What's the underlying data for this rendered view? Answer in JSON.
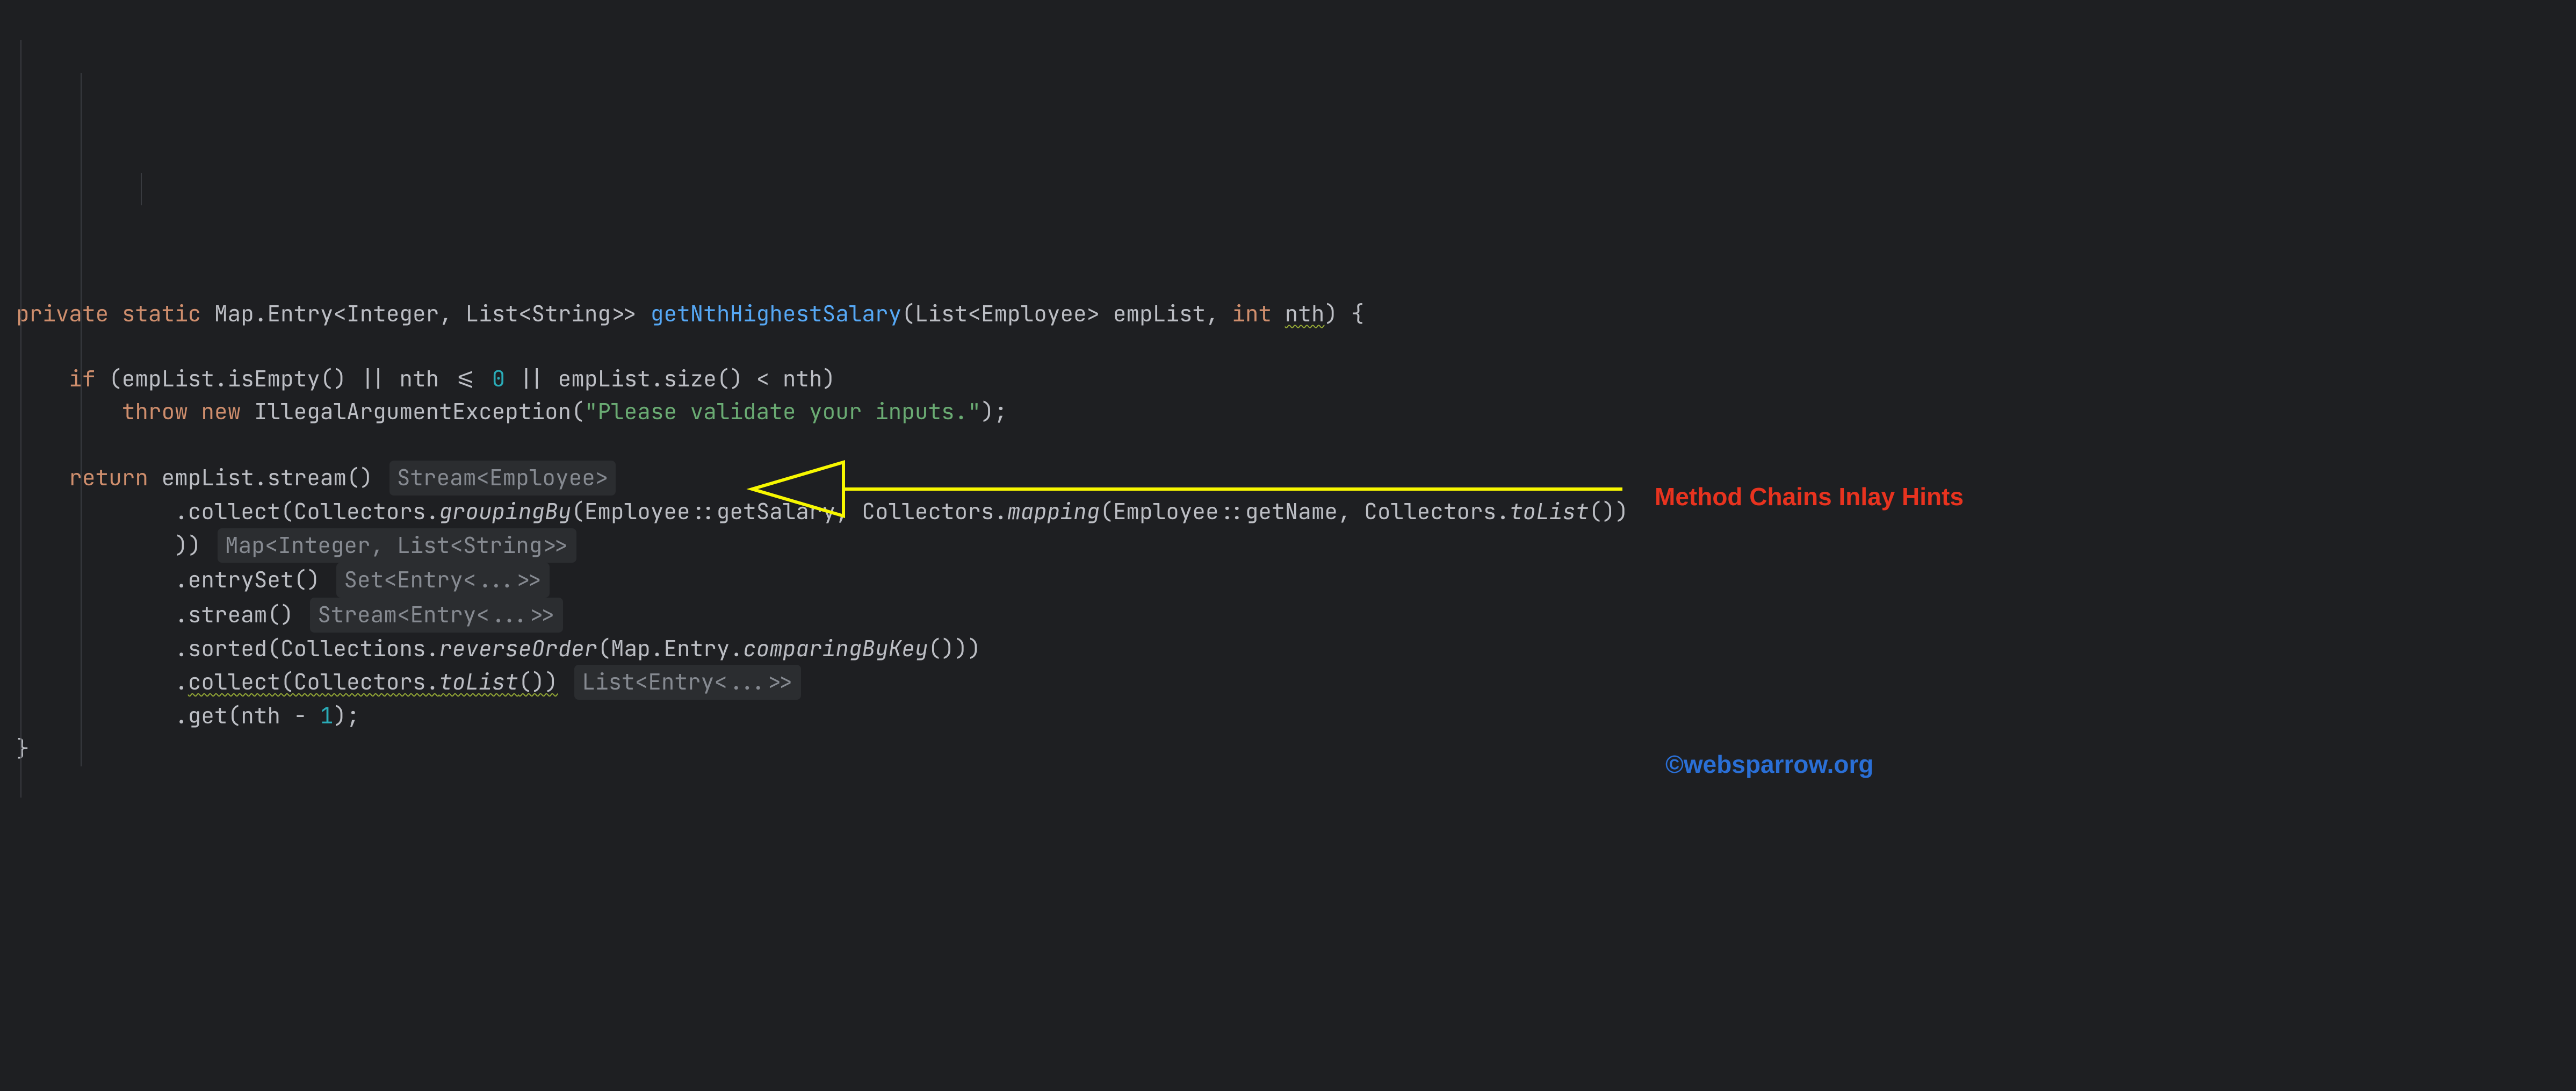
{
  "code": {
    "kw_private": "private",
    "kw_static": "static",
    "ret_type": "Map.Entry<Integer, List<String>>",
    "fn_name": "getNthHighestSalary",
    "param_list_open": "(List<Employee> empList, ",
    "kw_int": "int",
    "param_nth": "nth",
    "paren_close_brace": ") {",
    "if_line": "if (empList.isEmpty() || nth <= ",
    "zero": "0",
    "if_cont": " || empList.size() < nth)",
    "kw_throw": "throw",
    "kw_new": "new",
    "exc_type": "IllegalArgumentException(",
    "exc_msg": "\"Please validate your inputs.\"",
    "exc_close": ");",
    "kw_return": "return",
    "stream_call": " empList.stream()",
    "hint_stream_emp": "Stream<Employee>",
    "collect1_a": ".collect(Collectors.",
    "groupingBy": "groupingBy",
    "collect1_b": "(Employee::getSalary, Collectors.",
    "mapping": "mapping",
    "collect1_c": "(Employee::getName, Collectors.",
    "toList1": "toList",
    "collect1_d": "())",
    "collect1_close": "))",
    "hint_map": "Map<Integer, List<String>>",
    "entrySet": ".entrySet()",
    "hint_set": "Set<Entry<...>>",
    "stream2": ".stream()",
    "hint_stream2": "Stream<Entry<...>>",
    "sorted_a": ".sorted(Collections.",
    "reverseOrder": "reverseOrder",
    "sorted_b": "(Map.Entry.",
    "comparingByKey": "comparingByKey",
    "sorted_c": "()))",
    "collect2_a": ".",
    "collect2_b": "collect(Collectors.",
    "toList2": "toList",
    "collect2_c": "())",
    "hint_list": "List<Entry<...>>",
    "get_a": ".get(nth - ",
    "one": "1",
    "get_b": ");",
    "close_brace": "}"
  },
  "annotation": {
    "label": "Method Chains Inlay Hints",
    "copyright": "©websparrow.org"
  },
  "colors": {
    "bg": "#1e1f22",
    "keyword": "#cf8e6d",
    "func": "#56a8f5",
    "number": "#2aacb8",
    "string": "#6aab73",
    "hintbg": "#2b2d30",
    "hintfg": "#868a91",
    "arrow": "#f7f700",
    "red": "#e8331f",
    "link": "#2a6fd6"
  }
}
